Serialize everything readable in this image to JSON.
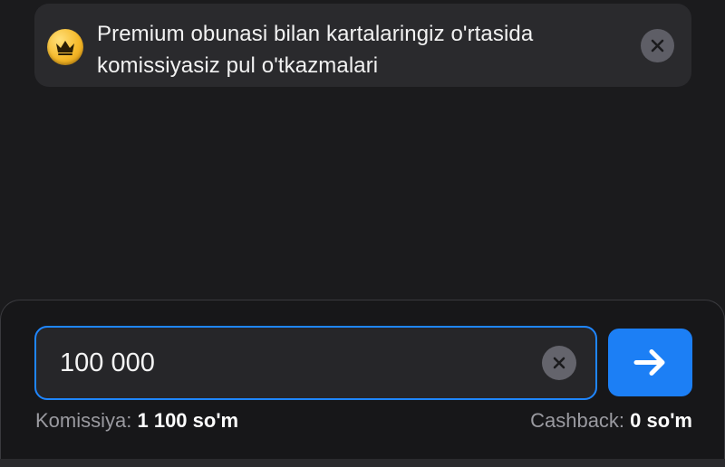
{
  "promo": {
    "line1": "Premium obunasi bilan kartalaringiz o'rtasida",
    "line2": "komissiyasiz pul o'tkazmalari",
    "badge_icon": "crown-icon",
    "close_icon": "close-icon",
    "badge_color": "#f5b92a"
  },
  "transfer": {
    "amount_value": "100 000",
    "clear_icon": "clear-icon",
    "submit_icon": "arrow-right-icon",
    "accent_color": "#1c7ff5",
    "commission_label": "Komissiya:",
    "commission_value": "1 100 so'm",
    "cashback_label": "Cashback:",
    "cashback_value": "0 so'm"
  }
}
